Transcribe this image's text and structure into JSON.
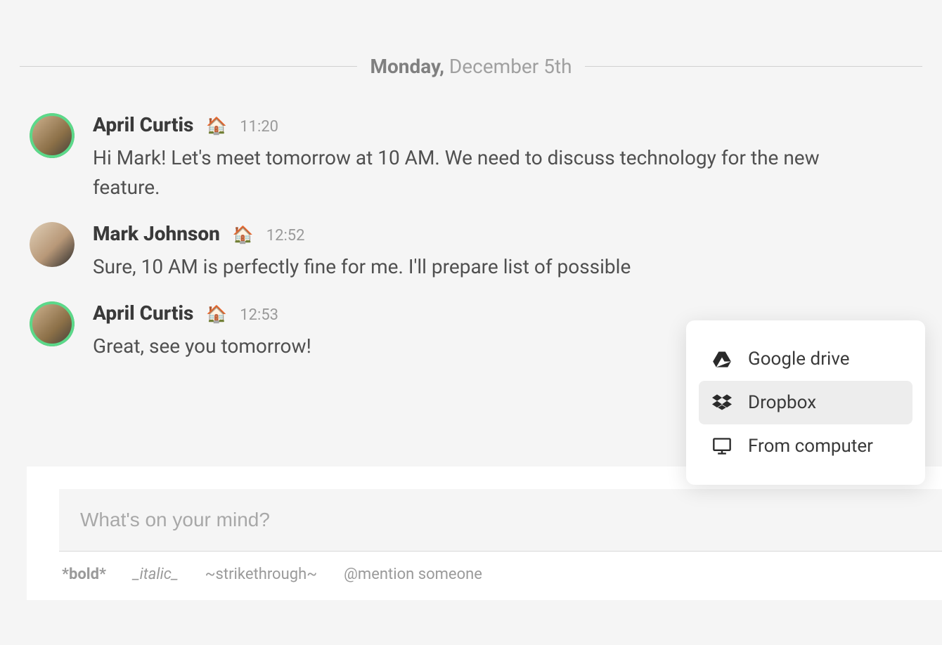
{
  "date_divider": {
    "day_of_week": "Monday,",
    "date_rest": " December 5th"
  },
  "messages": [
    {
      "author": "April Curtis",
      "status_emoji": "🏠",
      "time": "11:20",
      "text": "Hi Mark! Let's meet tomorrow at 10 AM. We need to discuss technology for the new feature.",
      "online": true
    },
    {
      "author": "Mark Johnson",
      "status_emoji": "🏠",
      "time": "12:52",
      "text": "Sure, 10 AM is perfectly fine for me. I'll prepare list of possible",
      "online": false
    },
    {
      "author": "April Curtis",
      "status_emoji": "🏠",
      "time": "12:53",
      "text": "Great, see you tomorrow!",
      "online": true
    }
  ],
  "composer": {
    "placeholder": "What's on your mind?",
    "hints": {
      "bold": "*bold*",
      "italic": "_italic_",
      "strike": "~strikethrough~",
      "mention": "@mention someone"
    }
  },
  "attach_menu": {
    "items": [
      {
        "label": "Google drive",
        "icon": "google-drive",
        "hover": false
      },
      {
        "label": "Dropbox",
        "icon": "dropbox",
        "hover": true
      },
      {
        "label": "From computer",
        "icon": "computer",
        "hover": false
      }
    ]
  }
}
